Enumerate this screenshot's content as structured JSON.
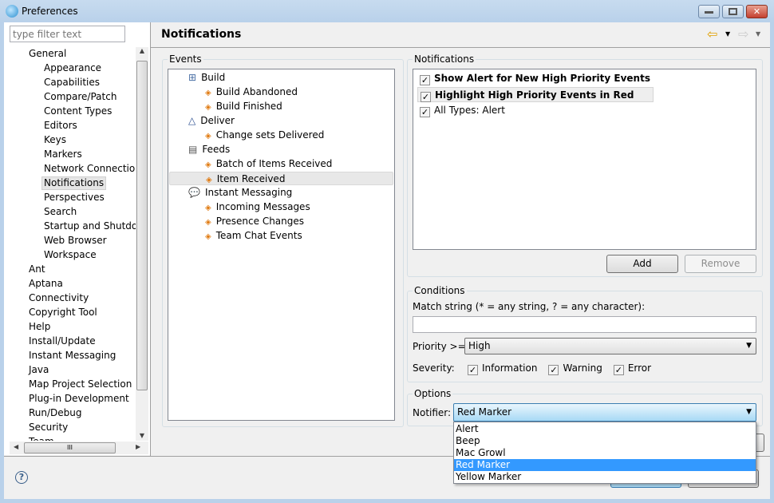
{
  "window": {
    "title": "Preferences"
  },
  "filter": {
    "placeholder": "type filter text"
  },
  "tree": [
    {
      "label": "General",
      "level": 0
    },
    {
      "label": "Appearance",
      "level": 1
    },
    {
      "label": "Capabilities",
      "level": 1
    },
    {
      "label": "Compare/Patch",
      "level": 1
    },
    {
      "label": "Content Types",
      "level": 1
    },
    {
      "label": "Editors",
      "level": 1
    },
    {
      "label": "Keys",
      "level": 1
    },
    {
      "label": "Markers",
      "level": 1
    },
    {
      "label": "Network Connections",
      "level": 1
    },
    {
      "label": "Notifications",
      "level": 1,
      "selected": true
    },
    {
      "label": "Perspectives",
      "level": 1
    },
    {
      "label": "Search",
      "level": 1
    },
    {
      "label": "Startup and Shutdown",
      "level": 1
    },
    {
      "label": "Web Browser",
      "level": 1
    },
    {
      "label": "Workspace",
      "level": 1
    },
    {
      "label": "Ant",
      "level": 0
    },
    {
      "label": "Aptana",
      "level": 0
    },
    {
      "label": "Connectivity",
      "level": 0
    },
    {
      "label": "Copyright Tool",
      "level": 0
    },
    {
      "label": "Help",
      "level": 0
    },
    {
      "label": "Install/Update",
      "level": 0
    },
    {
      "label": "Instant Messaging",
      "level": 0
    },
    {
      "label": "Java",
      "level": 0
    },
    {
      "label": "Map Project Selection",
      "level": 0
    },
    {
      "label": "Plug-in Development",
      "level": 0
    },
    {
      "label": "Run/Debug",
      "level": 0
    },
    {
      "label": "Security",
      "level": 0
    },
    {
      "label": "Team",
      "level": 0
    }
  ],
  "page": {
    "title": "Notifications"
  },
  "events": {
    "label": "Events",
    "items": [
      {
        "label": "Build",
        "level": 0,
        "icon": "hierarchy-icon"
      },
      {
        "label": "Build Abandoned",
        "level": 1
      },
      {
        "label": "Build Finished",
        "level": 1
      },
      {
        "label": "Deliver",
        "level": 0,
        "icon": "delta-icon"
      },
      {
        "label": "Change sets Delivered",
        "level": 1
      },
      {
        "label": "Feeds",
        "level": 0,
        "icon": "feed-icon"
      },
      {
        "label": "Batch of Items Received",
        "level": 1
      },
      {
        "label": "Item Received",
        "level": 1,
        "selected": true
      },
      {
        "label": "Instant Messaging",
        "level": 0,
        "icon": "chat-icon"
      },
      {
        "label": "Incoming Messages",
        "level": 1
      },
      {
        "label": "Presence Changes",
        "level": 1
      },
      {
        "label": "Team Chat Events",
        "level": 1
      }
    ]
  },
  "notifications": {
    "label": "Notifications",
    "items": [
      {
        "label": "Show Alert for New High Priority Events",
        "checked": true,
        "bold": true
      },
      {
        "label": "Highlight High Priority Events in Red",
        "checked": true,
        "bold": true
      },
      {
        "label": "All Types: Alert",
        "checked": true,
        "bold": false
      }
    ],
    "add": "Add",
    "remove": "Remove"
  },
  "conditions": {
    "label": "Conditions",
    "match_label": "Match string (* = any string, ? = any character):",
    "match_value": "",
    "priority_label": "Priority >=",
    "priority_value": "High",
    "severity_label": "Severity:",
    "severities": [
      {
        "label": "Information",
        "checked": true
      },
      {
        "label": "Warning",
        "checked": true
      },
      {
        "label": "Error",
        "checked": true
      }
    ]
  },
  "options": {
    "label": "Options",
    "notifier_label": "Notifier:",
    "notifier_value": "Red Marker",
    "notifier_options": [
      "Alert",
      "Beep",
      "Mac Growl",
      "Red Marker",
      "Yellow Marker"
    ],
    "selected_index": 3
  },
  "colors": {
    "selection": "#3399ff",
    "frame": "#b9d1ea"
  }
}
